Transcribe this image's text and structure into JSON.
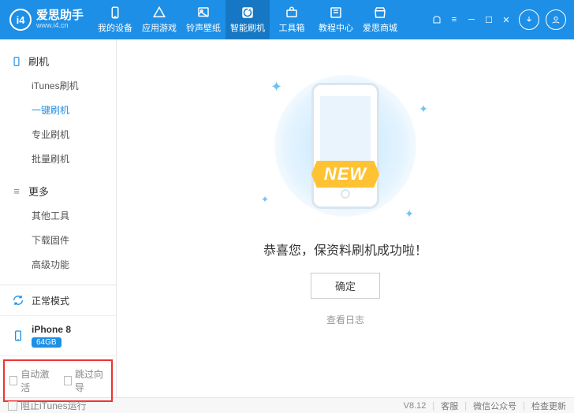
{
  "brand": {
    "badge": "i4",
    "title": "爱思助手",
    "subtitle": "www.i4.cn"
  },
  "topnav": {
    "items": [
      {
        "key": "devices",
        "label": "我的设备"
      },
      {
        "key": "apps",
        "label": "应用游戏"
      },
      {
        "key": "ringtones",
        "label": "铃声壁纸"
      },
      {
        "key": "flash",
        "label": "智能刷机",
        "active": true
      },
      {
        "key": "toolbox",
        "label": "工具箱"
      },
      {
        "key": "tutorials",
        "label": "教程中心"
      },
      {
        "key": "store",
        "label": "爱思商城"
      }
    ]
  },
  "sidebar": {
    "group1": {
      "title": "刷机",
      "items": [
        {
          "label": "iTunes刷机"
        },
        {
          "label": "一键刷机",
          "active": true
        },
        {
          "label": "专业刷机"
        },
        {
          "label": "批量刷机"
        }
      ]
    },
    "group2": {
      "title": "更多",
      "items": [
        {
          "label": "其他工具"
        },
        {
          "label": "下载固件"
        },
        {
          "label": "高级功能"
        }
      ]
    },
    "mode_label": "正常模式",
    "device": {
      "name": "iPhone 8",
      "storage": "64GB"
    },
    "checks": {
      "auto_activate": "自动激活",
      "skip_wizard": "跳过向导"
    }
  },
  "content": {
    "ribbon": "NEW",
    "message": "恭喜您，保资料刷机成功啦！",
    "ok": "确定",
    "view_log": "查看日志"
  },
  "footer": {
    "block_itunes": "阻止iTunes运行",
    "version": "V8.12",
    "links": {
      "support": "客服",
      "wechat": "微信公众号",
      "update": "检查更新"
    }
  }
}
